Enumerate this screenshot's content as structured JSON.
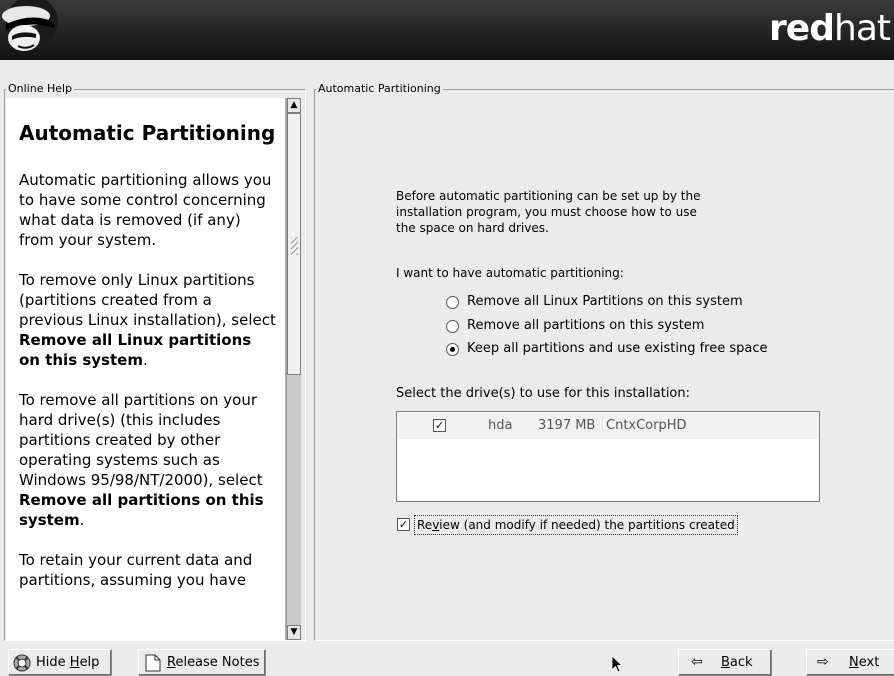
{
  "header": {
    "brand_bold": "red",
    "brand_light": "hat"
  },
  "help": {
    "frame_label": "Online Help",
    "title": "Automatic Partitioning",
    "p1": "Automatic partitioning allows you to have some control concerning what data is removed (if any) from your system.",
    "p2_pre": "To remove only Linux partitions (partitions created from a previous Linux installation), select ",
    "p2_bold": "Remove all Linux partitions on this system",
    "p2_post": ".",
    "p3_pre": "To remove all partitions on your hard drive(s) (this includes partitions created by other operating systems such as Windows 95/98/NT/2000), select ",
    "p3_bold": "Remove all partitions on this system",
    "p3_post": ".",
    "p4": "To retain your current data and partitions, assuming you have"
  },
  "main": {
    "frame_label": "Automatic Partitioning",
    "intro_line1": "Before automatic partitioning can be set up by the",
    "intro_line2": "installation program, you must choose how to use",
    "intro_line3": "the space on hard drives.",
    "want_label": "I want to have automatic partitioning:",
    "options": [
      {
        "label": "Remove all Linux Partitions on this system",
        "selected": false
      },
      {
        "label": "Remove all partitions on this system",
        "selected": false
      },
      {
        "label": "Keep all partitions and use existing free space",
        "selected": true
      }
    ],
    "select_label": "Select the drive(s) to use for this installation:",
    "drive": {
      "checked": true,
      "name": "hda",
      "size": "3197 MB",
      "model": "CntxCorpHD"
    },
    "review": {
      "checked": true,
      "label_pre": "Re",
      "label_accel": "v",
      "label_post": "iew (and modify if needed) the partitions created"
    }
  },
  "buttons": {
    "hide_help_pre": "Hide ",
    "hide_help_accel": "H",
    "hide_help_post": "elp",
    "release_notes_accel": "R",
    "release_notes_post": "elease Notes",
    "back_accel": "B",
    "back_post": "ack",
    "next_accel": "N",
    "next_post": "ext"
  }
}
